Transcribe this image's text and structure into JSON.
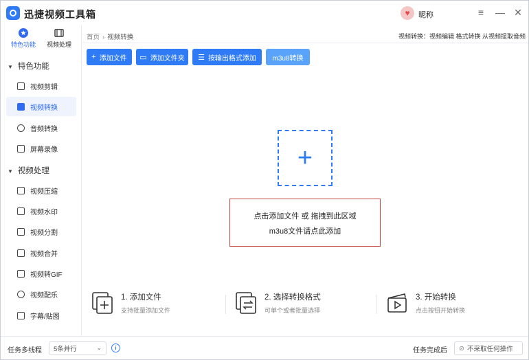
{
  "app": {
    "title": "迅捷视频工具箱",
    "username": "昵称"
  },
  "sidebar": {
    "tabs": [
      {
        "label": "特色功能",
        "icon": "star-icon"
      },
      {
        "label": "视频处理",
        "icon": "film-icon"
      }
    ],
    "sections": [
      {
        "label": "特色功能",
        "items": [
          {
            "label": "视频剪辑",
            "icon": "video-edit-icon"
          },
          {
            "label": "视频转换",
            "icon": "video-convert-icon"
          },
          {
            "label": "音频转换",
            "icon": "audio-convert-icon"
          },
          {
            "label": "屏幕录像",
            "icon": "screen-record-icon"
          }
        ]
      },
      {
        "label": "视频处理",
        "items": [
          {
            "label": "视频压缩",
            "icon": "compress-icon"
          },
          {
            "label": "视频水印",
            "icon": "watermark-icon"
          },
          {
            "label": "视频分割",
            "icon": "split-icon"
          },
          {
            "label": "视频合并",
            "icon": "merge-icon"
          },
          {
            "label": "视频转GIF",
            "icon": "gif-icon"
          },
          {
            "label": "视频配乐",
            "icon": "music-icon"
          },
          {
            "label": "字幕/贴图",
            "icon": "subtitle-icon"
          }
        ]
      }
    ]
  },
  "breadcrumb": {
    "home": "首页",
    "separator": "›",
    "current": "视频转换"
  },
  "hint": "视频转换：视频编辑 格式转换 从视频提取音频",
  "toolbar": {
    "add_file": "添加文件",
    "add_folder": "添加文件夹",
    "add_by_format": "按输出格式添加",
    "m3u8": "m3u8转换"
  },
  "dropzone": {
    "line1": "点击添加文件 或 拖拽到此区域",
    "line2": "m3u8文件请点此添加"
  },
  "steps": [
    {
      "title": "1. 添加文件",
      "desc": "支持批量添加文件"
    },
    {
      "title": "2. 选择转换格式",
      "desc": "可单个或者批量选择"
    },
    {
      "title": "3. 开始转换",
      "desc": "点击按钮开始转换"
    }
  ],
  "footer": {
    "threads_label": "任务多线程",
    "threads_value": "5条并行",
    "done_label": "任务完成后",
    "done_value": "不采取任何操作"
  },
  "colors": {
    "accent": "#2f7bf6",
    "highlight_border": "#c8433b",
    "active_nav_bg": "#eef3fe"
  }
}
